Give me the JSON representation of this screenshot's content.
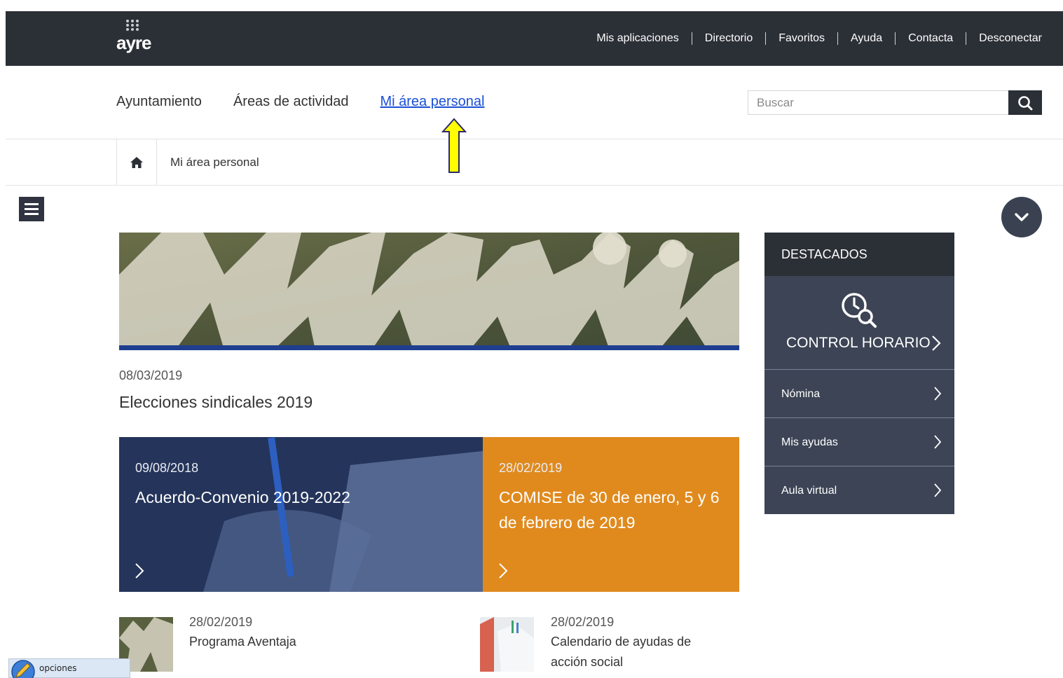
{
  "header": {
    "logo_text": "ayre",
    "links": [
      "Mis aplicaciones",
      "Directorio",
      "Favoritos",
      "Ayuda",
      "Contacta",
      "Desconectar"
    ]
  },
  "nav": {
    "items": [
      "Ayuntamiento",
      "Áreas de actividad",
      "Mi área personal"
    ],
    "active_index": 2
  },
  "search": {
    "placeholder": "Buscar"
  },
  "breadcrumb": {
    "current": "Mi área personal"
  },
  "hero": {
    "date": "08/03/2019",
    "title": "Elecciones sindicales 2019"
  },
  "cards": [
    {
      "date": "09/08/2018",
      "title": "Acuerdo-Convenio 2019-2022"
    },
    {
      "date": "28/02/2019",
      "title": "COMISE de 30 de enero, 5 y 6 de febrero de 2019"
    }
  ],
  "sidebar": {
    "heading": "DESTACADOS",
    "feature": "CONTROL HORARIO",
    "items": [
      "Nómina",
      "Mis ayudas",
      "Aula virtual"
    ]
  },
  "news": [
    {
      "date": "28/02/2019",
      "title": "Programa Aventaja"
    },
    {
      "date": "28/02/2019",
      "title": "Calendario de ayudas de acción social"
    }
  ],
  "options_widget": {
    "label": "opciones"
  },
  "colors": {
    "topbar": "#2b2f36",
    "active_link": "#1a4fd6",
    "card_blue": "#2a3a5e",
    "card_orange": "#e08a1e",
    "sidebar": "#3c4455",
    "annotation_arrow": "#ffff00"
  }
}
